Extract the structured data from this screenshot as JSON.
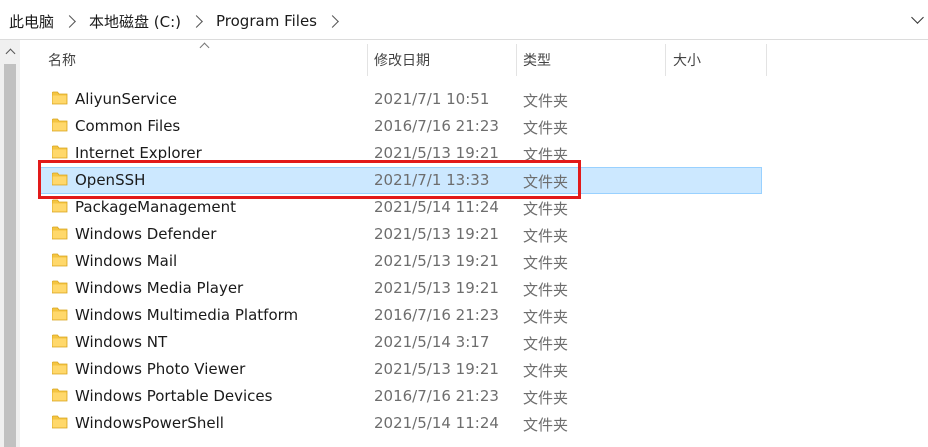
{
  "breadcrumb": [
    "此电脑",
    "本地磁盘 (C:)",
    "Program Files"
  ],
  "columns": {
    "name": "名称",
    "date": "修改日期",
    "type": "类型",
    "size": "大小"
  },
  "folder_color": "#f4c542",
  "selected_color": "#cce8ff",
  "annotation_color": "#e21a1a",
  "files": [
    {
      "name": "AliyunService",
      "date": "2021/7/1 10:51",
      "type": "文件夹"
    },
    {
      "name": "Common Files",
      "date": "2016/7/16 21:23",
      "type": "文件夹"
    },
    {
      "name": "Internet Explorer",
      "date": "2021/5/13 19:21",
      "type": "文件夹"
    },
    {
      "name": "OpenSSH",
      "date": "2021/7/1 13:33",
      "type": "文件夹",
      "selected": true
    },
    {
      "name": "PackageManagement",
      "date": "2021/5/14 11:24",
      "type": "文件夹"
    },
    {
      "name": "Windows Defender",
      "date": "2021/5/13 19:21",
      "type": "文件夹"
    },
    {
      "name": "Windows Mail",
      "date": "2021/5/13 19:21",
      "type": "文件夹"
    },
    {
      "name": "Windows Media Player",
      "date": "2021/5/13 19:21",
      "type": "文件夹"
    },
    {
      "name": "Windows Multimedia Platform",
      "date": "2016/7/16 21:23",
      "type": "文件夹"
    },
    {
      "name": "Windows NT",
      "date": "2021/5/14 3:17",
      "type": "文件夹"
    },
    {
      "name": "Windows Photo Viewer",
      "date": "2021/5/13 19:21",
      "type": "文件夹"
    },
    {
      "name": "Windows Portable Devices",
      "date": "2016/7/16 21:23",
      "type": "文件夹"
    },
    {
      "name": "WindowsPowerShell",
      "date": "2021/5/14 11:24",
      "type": "文件夹"
    }
  ]
}
